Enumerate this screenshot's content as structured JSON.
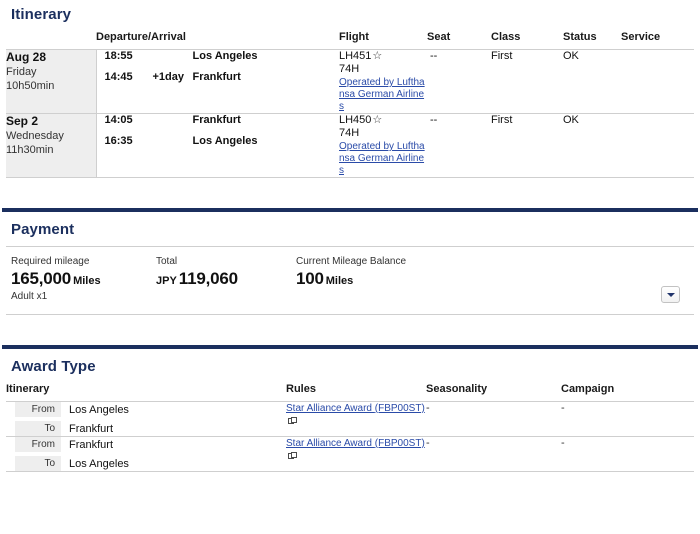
{
  "itinerary": {
    "title": "Itinerary",
    "columns": [
      "",
      "Departure/Arrival",
      "Flight",
      "Seat",
      "Class",
      "Status",
      "Service"
    ],
    "rows": [
      {
        "date": "Aug 28",
        "weekday": "Friday",
        "duration": "10h50min",
        "legs": [
          {
            "time": "18:55",
            "offset": "",
            "city": "Los Angeles"
          },
          {
            "time": "14:45",
            "offset": "+1day",
            "city": "Frankfurt"
          }
        ],
        "flight_no": "LH451",
        "star": "☆",
        "aircraft": "74H",
        "operated_by": "Operated by Lufthansa German Airlines",
        "seat": "--",
        "class": "First",
        "status": "OK",
        "service": ""
      },
      {
        "date": "Sep 2",
        "weekday": "Wednesday",
        "duration": "11h30min",
        "legs": [
          {
            "time": "14:05",
            "offset": "",
            "city": "Frankfurt"
          },
          {
            "time": "16:35",
            "offset": "",
            "city": "Los Angeles"
          }
        ],
        "flight_no": "LH450",
        "star": "☆",
        "aircraft": "74H",
        "operated_by": "Operated by Lufthansa German Airlines",
        "seat": "--",
        "class": "First",
        "status": "OK",
        "service": ""
      }
    ]
  },
  "payment": {
    "title": "Payment",
    "required_mileage": {
      "label": "Required mileage",
      "amount": "165,000",
      "unit": "Miles",
      "note": "Adult x1"
    },
    "total": {
      "label": "Total",
      "currency": "JPY",
      "amount": "119,060"
    },
    "balance": {
      "label": "Current Mileage Balance",
      "amount": "100",
      "unit": "Miles"
    },
    "expand_button": "expand-details"
  },
  "award_type": {
    "title": "Award Type",
    "columns": [
      "Itinerary",
      "Rules",
      "Seasonality",
      "Campaign"
    ],
    "labels": {
      "from": "From",
      "to": "To"
    },
    "rows": [
      {
        "from": "Los Angeles",
        "to": "Frankfurt",
        "rule_name": "Star Alliance Award",
        "rule_code": "(FBP00ST)",
        "seasonality": "-",
        "campaign": "-"
      },
      {
        "from": "Frankfurt",
        "to": "Los Angeles",
        "rule_name": "Star Alliance Award",
        "rule_code": "(FBP00ST)",
        "seasonality": "-",
        "campaign": "-"
      }
    ]
  },
  "colors": {
    "heading": "#1b2f5e",
    "rule": "#1b2f5e",
    "link": "#2a4ba8",
    "cell_bg": "#eeeeee"
  }
}
